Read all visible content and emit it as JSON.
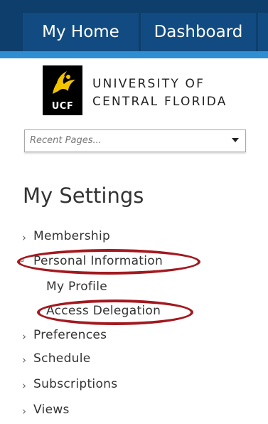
{
  "topnav": {
    "tabs": [
      {
        "label": "My Home"
      },
      {
        "label": "Dashboard"
      }
    ]
  },
  "logo": {
    "mark_text": "UCF",
    "line1": "UNIVERSITY OF",
    "line2": "CENTRAL FLORIDA"
  },
  "recent_pages": {
    "placeholder": "Recent Pages...",
    "icon": "chevron-down-icon"
  },
  "settings": {
    "title": "My Settings",
    "items": [
      {
        "label": "Membership",
        "state": "collapsed"
      },
      {
        "label": "Personal Information",
        "state": "expanded",
        "highlighted": true,
        "children": [
          {
            "label": "My Profile"
          },
          {
            "label": "Access Delegation",
            "highlighted": true
          }
        ]
      },
      {
        "label": "Preferences",
        "state": "collapsed"
      },
      {
        "label": "Schedule",
        "state": "collapsed"
      },
      {
        "label": "Subscriptions",
        "state": "collapsed"
      },
      {
        "label": "Views",
        "state": "collapsed"
      }
    ]
  },
  "colors": {
    "topbar": "#0e3e6b",
    "tab": "#114b81",
    "accent": "#2f8ed2",
    "highlight_ring": "#a2191f"
  }
}
